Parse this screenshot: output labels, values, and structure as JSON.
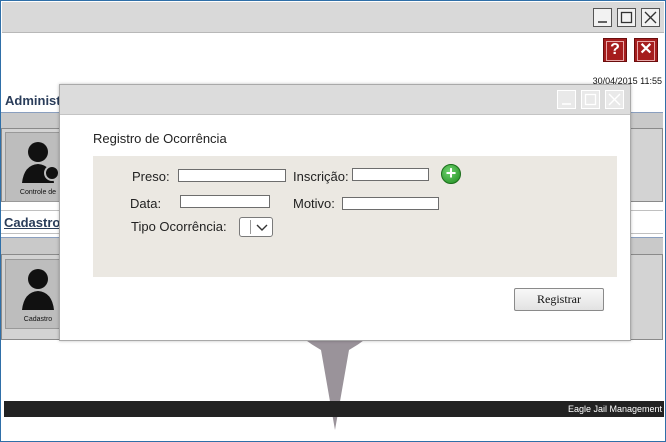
{
  "window": {
    "datetime": "30/04/2015  11:55",
    "footer_text": "Eagle Jail Management"
  },
  "buttons": {
    "help_label": "?",
    "close_label": "✕"
  },
  "sections": {
    "administrative_title": "Administrativo",
    "cadastro_title": "Cadastros"
  },
  "tiles": {
    "controle_label": "Controle de",
    "cadastro_label": "Cadastro"
  },
  "dialog": {
    "title": "Registro de Ocorrência",
    "fields": {
      "preso_label": "Preso:",
      "preso_value": "",
      "inscricao_label": "Inscrição:",
      "inscricao_value": "",
      "data_label": "Data:",
      "data_value": "",
      "motivo_label": "Motivo:",
      "motivo_value": "",
      "tipo_label": "Tipo Ocorrência:",
      "tipo_value": ""
    },
    "add_icon": "plus-circle-icon",
    "submit_label": "Registrar"
  },
  "colors": {
    "accent_red": "#a51d1d",
    "add_green": "#2a9a2a",
    "form_bg": "#ebe8e2"
  }
}
